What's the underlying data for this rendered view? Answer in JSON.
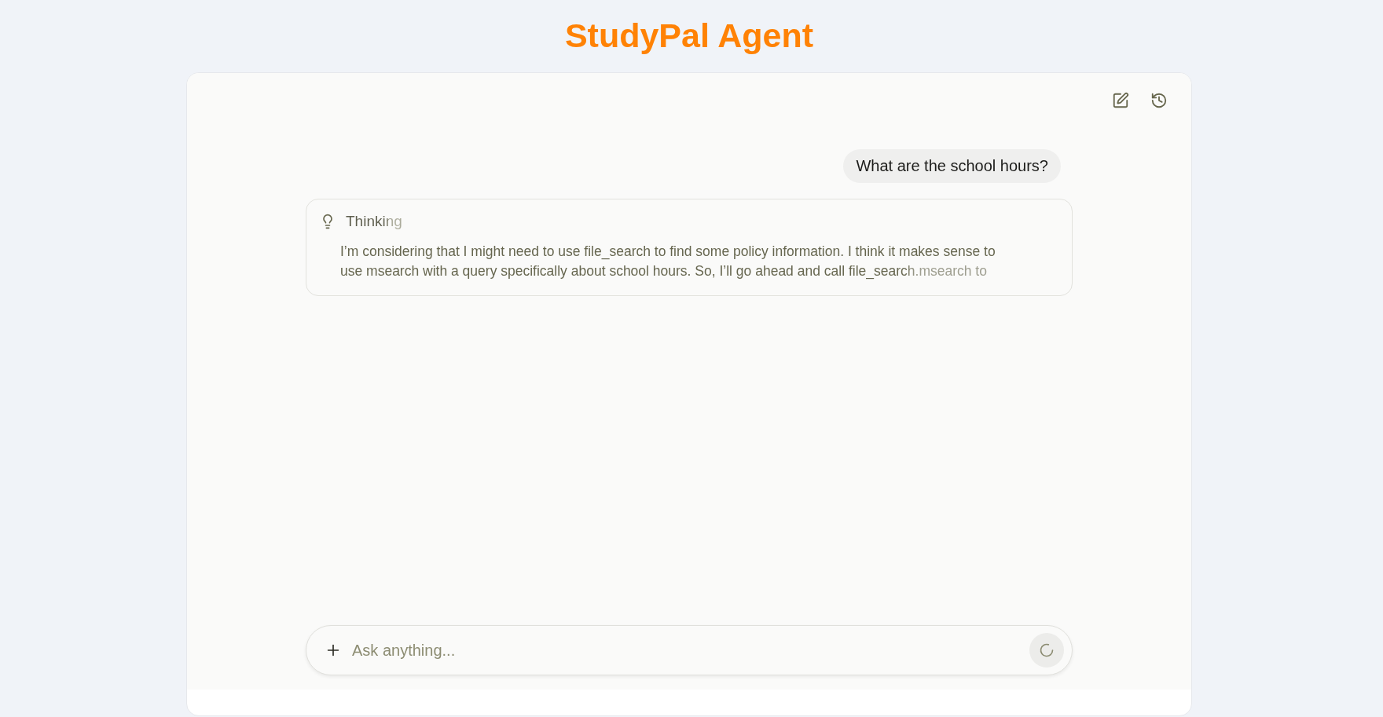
{
  "app_title": "StudyPal Agent",
  "messages": [
    {
      "kind": "user",
      "text": "What are the school hours?"
    },
    {
      "kind": "thinking",
      "label": "Thinking",
      "text": "I’m considering that I might need to use file_search to find some policy information. I think it makes sense to use msearch with a query specifically about school hours. So, I’ll go ahead and call file_search.msearch to"
    }
  ],
  "composer": {
    "placeholder": "Ask anything...",
    "busy": true
  }
}
